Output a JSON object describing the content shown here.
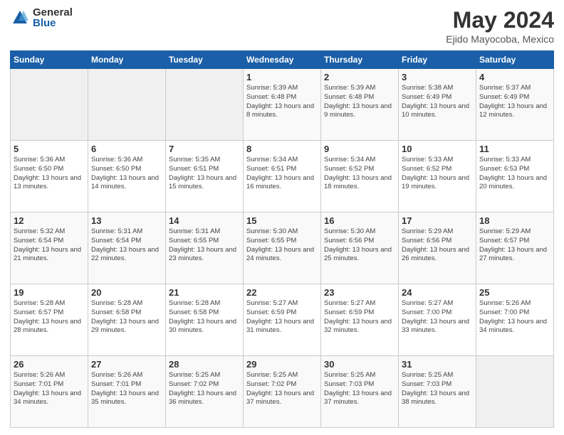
{
  "logo": {
    "general": "General",
    "blue": "Blue"
  },
  "title": "May 2024",
  "subtitle": "Ejido Mayocoba, Mexico",
  "days_header": [
    "Sunday",
    "Monday",
    "Tuesday",
    "Wednesday",
    "Thursday",
    "Friday",
    "Saturday"
  ],
  "weeks": [
    [
      {
        "day": "",
        "info": ""
      },
      {
        "day": "",
        "info": ""
      },
      {
        "day": "",
        "info": ""
      },
      {
        "day": "1",
        "info": "Sunrise: 5:39 AM\nSunset: 6:48 PM\nDaylight: 13 hours\nand 8 minutes."
      },
      {
        "day": "2",
        "info": "Sunrise: 5:39 AM\nSunset: 6:48 PM\nDaylight: 13 hours\nand 9 minutes."
      },
      {
        "day": "3",
        "info": "Sunrise: 5:38 AM\nSunset: 6:49 PM\nDaylight: 13 hours\nand 10 minutes."
      },
      {
        "day": "4",
        "info": "Sunrise: 5:37 AM\nSunset: 6:49 PM\nDaylight: 13 hours\nand 12 minutes."
      }
    ],
    [
      {
        "day": "5",
        "info": "Sunrise: 5:36 AM\nSunset: 6:50 PM\nDaylight: 13 hours\nand 13 minutes."
      },
      {
        "day": "6",
        "info": "Sunrise: 5:36 AM\nSunset: 6:50 PM\nDaylight: 13 hours\nand 14 minutes."
      },
      {
        "day": "7",
        "info": "Sunrise: 5:35 AM\nSunset: 6:51 PM\nDaylight: 13 hours\nand 15 minutes."
      },
      {
        "day": "8",
        "info": "Sunrise: 5:34 AM\nSunset: 6:51 PM\nDaylight: 13 hours\nand 16 minutes."
      },
      {
        "day": "9",
        "info": "Sunrise: 5:34 AM\nSunset: 6:52 PM\nDaylight: 13 hours\nand 18 minutes."
      },
      {
        "day": "10",
        "info": "Sunrise: 5:33 AM\nSunset: 6:52 PM\nDaylight: 13 hours\nand 19 minutes."
      },
      {
        "day": "11",
        "info": "Sunrise: 5:33 AM\nSunset: 6:53 PM\nDaylight: 13 hours\nand 20 minutes."
      }
    ],
    [
      {
        "day": "12",
        "info": "Sunrise: 5:32 AM\nSunset: 6:54 PM\nDaylight: 13 hours\nand 21 minutes."
      },
      {
        "day": "13",
        "info": "Sunrise: 5:31 AM\nSunset: 6:54 PM\nDaylight: 13 hours\nand 22 minutes."
      },
      {
        "day": "14",
        "info": "Sunrise: 5:31 AM\nSunset: 6:55 PM\nDaylight: 13 hours\nand 23 minutes."
      },
      {
        "day": "15",
        "info": "Sunrise: 5:30 AM\nSunset: 6:55 PM\nDaylight: 13 hours\nand 24 minutes."
      },
      {
        "day": "16",
        "info": "Sunrise: 5:30 AM\nSunset: 6:56 PM\nDaylight: 13 hours\nand 25 minutes."
      },
      {
        "day": "17",
        "info": "Sunrise: 5:29 AM\nSunset: 6:56 PM\nDaylight: 13 hours\nand 26 minutes."
      },
      {
        "day": "18",
        "info": "Sunrise: 5:29 AM\nSunset: 6:57 PM\nDaylight: 13 hours\nand 27 minutes."
      }
    ],
    [
      {
        "day": "19",
        "info": "Sunrise: 5:28 AM\nSunset: 6:57 PM\nDaylight: 13 hours\nand 28 minutes."
      },
      {
        "day": "20",
        "info": "Sunrise: 5:28 AM\nSunset: 6:58 PM\nDaylight: 13 hours\nand 29 minutes."
      },
      {
        "day": "21",
        "info": "Sunrise: 5:28 AM\nSunset: 6:58 PM\nDaylight: 13 hours\nand 30 minutes."
      },
      {
        "day": "22",
        "info": "Sunrise: 5:27 AM\nSunset: 6:59 PM\nDaylight: 13 hours\nand 31 minutes."
      },
      {
        "day": "23",
        "info": "Sunrise: 5:27 AM\nSunset: 6:59 PM\nDaylight: 13 hours\nand 32 minutes."
      },
      {
        "day": "24",
        "info": "Sunrise: 5:27 AM\nSunset: 7:00 PM\nDaylight: 13 hours\nand 33 minutes."
      },
      {
        "day": "25",
        "info": "Sunrise: 5:26 AM\nSunset: 7:00 PM\nDaylight: 13 hours\nand 34 minutes."
      }
    ],
    [
      {
        "day": "26",
        "info": "Sunrise: 5:26 AM\nSunset: 7:01 PM\nDaylight: 13 hours\nand 34 minutes."
      },
      {
        "day": "27",
        "info": "Sunrise: 5:26 AM\nSunset: 7:01 PM\nDaylight: 13 hours\nand 35 minutes."
      },
      {
        "day": "28",
        "info": "Sunrise: 5:25 AM\nSunset: 7:02 PM\nDaylight: 13 hours\nand 36 minutes."
      },
      {
        "day": "29",
        "info": "Sunrise: 5:25 AM\nSunset: 7:02 PM\nDaylight: 13 hours\nand 37 minutes."
      },
      {
        "day": "30",
        "info": "Sunrise: 5:25 AM\nSunset: 7:03 PM\nDaylight: 13 hours\nand 37 minutes."
      },
      {
        "day": "31",
        "info": "Sunrise: 5:25 AM\nSunset: 7:03 PM\nDaylight: 13 hours\nand 38 minutes."
      },
      {
        "day": "",
        "info": ""
      }
    ]
  ]
}
